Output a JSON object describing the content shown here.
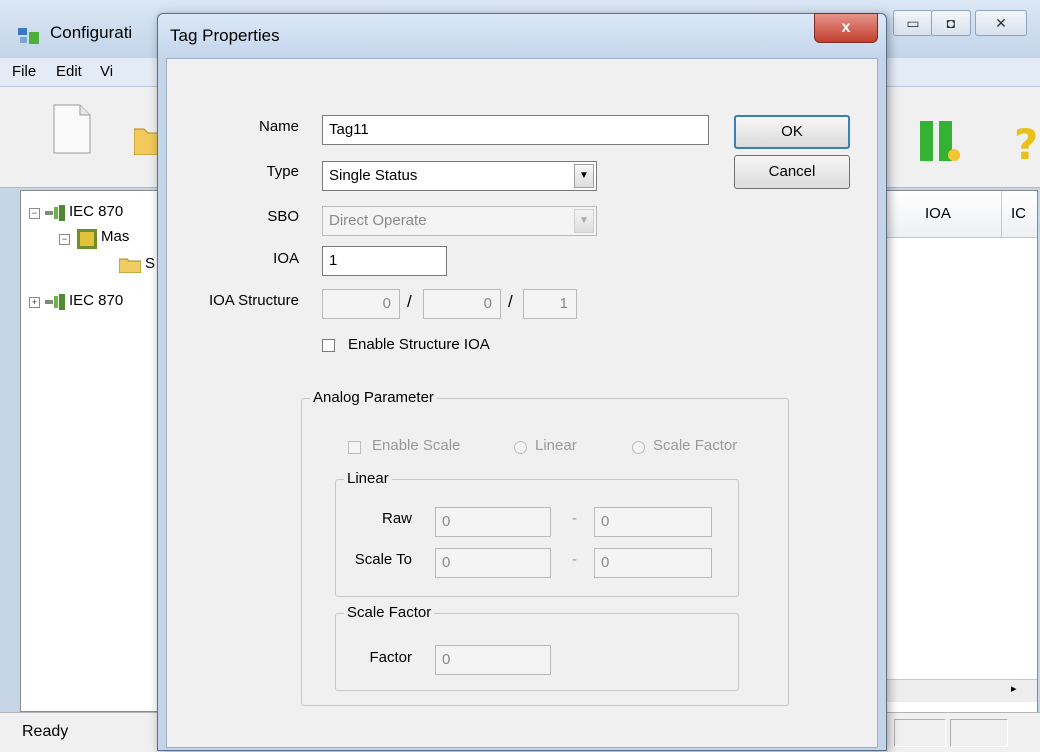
{
  "main": {
    "title": "Configurati",
    "menu": [
      "File",
      "Edit",
      "Vi"
    ],
    "tree": [
      "IEC 870",
      "Mas",
      "S",
      "IEC 870"
    ],
    "columns": [
      "IOA",
      "IC"
    ],
    "status": "Ready"
  },
  "dialog": {
    "title": "Tag Properties",
    "close_glyph": "x",
    "labels": {
      "name": "Name",
      "type": "Type",
      "sbo": "SBO",
      "ioa": "IOA",
      "ioa_structure": "IOA Structure"
    },
    "name_value": "Tag11",
    "type_value": "Single Status",
    "sbo_value": "Direct Operate",
    "ioa_value": "1",
    "ioa_structure": [
      "0",
      "0",
      "1"
    ],
    "separator": "/",
    "enable_structure_label": "Enable Structure IOA",
    "ok_label": "OK",
    "cancel_label": "Cancel",
    "analog": {
      "title": "Analog Parameter",
      "enable_scale": "Enable Scale",
      "linear_radio": "Linear",
      "scale_factor_radio": "Scale Factor",
      "linear_group": "Linear",
      "raw_label": "Raw",
      "scale_to_label": "Scale To",
      "dash": "-",
      "raw_from": "0",
      "raw_to": "0",
      "scale_from": "0",
      "scale_to": "0",
      "factor_group": "Scale Factor",
      "factor_label": "Factor",
      "factor_value": "0"
    }
  }
}
